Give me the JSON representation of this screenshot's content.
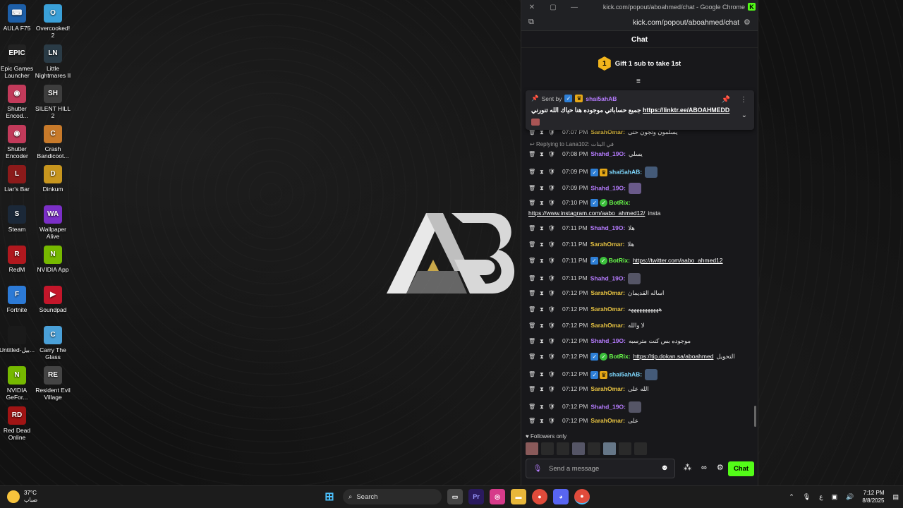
{
  "desktop": {
    "icons": [
      {
        "label": "AULA F75",
        "icon": "keyboard-app-icon",
        "color": "#1d5fa8",
        "glyph": "⌨"
      },
      {
        "label": "Overcooked! 2",
        "icon": "overcooked-icon",
        "color": "#3aa0d8",
        "glyph": "O"
      },
      {
        "label": "Epic Games Launcher",
        "icon": "epic-games-icon",
        "color": "#222222",
        "glyph": "EPIC"
      },
      {
        "label": "Little Nightmares II",
        "icon": "little-nightmares-icon",
        "color": "#2a3b46",
        "glyph": "LN"
      },
      {
        "label": "Shutter Encod...",
        "icon": "shutter-encoder-icon",
        "color": "#c23a5a",
        "glyph": "◉"
      },
      {
        "label": "SILENT HILL 2",
        "icon": "silent-hill-icon",
        "color": "#3d3d3d",
        "glyph": "SH"
      },
      {
        "label": "Shutter Encoder",
        "icon": "shutter-encoder-icon",
        "color": "#c23a5a",
        "glyph": "◉"
      },
      {
        "label": "Crash Bandicoot...",
        "icon": "crash-icon",
        "color": "#c87a2a",
        "glyph": "C"
      },
      {
        "label": "Liar's Bar",
        "icon": "liars-bar-icon",
        "color": "#8c1a1a",
        "glyph": "L"
      },
      {
        "label": "Dinkum",
        "icon": "dinkum-icon",
        "color": "#c8961e",
        "glyph": "D"
      },
      {
        "label": "Steam",
        "icon": "steam-icon",
        "color": "#1b2838",
        "glyph": "S"
      },
      {
        "label": "Wallpaper Alive",
        "icon": "wallpaper-alive-icon",
        "color": "#7b2fc7",
        "glyph": "WA"
      },
      {
        "label": "RedM",
        "icon": "redm-icon",
        "color": "#b0181e",
        "glyph": "R"
      },
      {
        "label": "NVIDIA App",
        "icon": "nvidia-icon",
        "color": "#76b900",
        "glyph": "N"
      },
      {
        "label": "Fortnite",
        "icon": "fortnite-icon",
        "color": "#2c7ad6",
        "glyph": "F"
      },
      {
        "label": "Soundpad",
        "icon": "soundpad-icon",
        "color": "#c4162a",
        "glyph": "▶"
      },
      {
        "label": "Untitled-بيل...",
        "icon": "untitled-file-icon",
        "color": "#1a1a1a",
        "glyph": ""
      },
      {
        "label": "Carry The Glass",
        "icon": "carry-the-glass-icon",
        "color": "#4aa0d8",
        "glyph": "C"
      },
      {
        "label": "NVIDIA GeFor...",
        "icon": "nvidia-geforce-icon",
        "color": "#76b900",
        "glyph": "N"
      },
      {
        "label": "Resident Evil Village",
        "icon": "resident-evil-icon",
        "color": "#444444",
        "glyph": "RE"
      },
      {
        "label": "Red Dead Online",
        "icon": "red-dead-icon",
        "color": "#a01414",
        "glyph": "RD"
      }
    ]
  },
  "chrome": {
    "title": "kick.com/popout/aboahmed/chat - Google Chrome",
    "url": "kick.com/popout/aboahmed/chat"
  },
  "chat": {
    "header": "Chat",
    "gift_badge": "1",
    "gift_text": "Gift 1 sub to take 1st",
    "pinned": {
      "sent_by_label": "Sent by",
      "sender": "shai5ahAB",
      "text": "جميع حساباتي موجوده هنا حياك الله تنورني",
      "link": "https://linktr.ee/ABOAHMEDD"
    },
    "messages": [
      {
        "time": "07:07 PM",
        "user": "SarahOmar:",
        "cls": "u-yellow",
        "text": "يسلمون وتجون حتى"
      },
      {
        "time": "07:08 PM",
        "user": "Shahd_19O:",
        "cls": "u-purple",
        "text": "يسلي"
      },
      {
        "time": "07:09 PM",
        "user": "shai5ahAB:",
        "cls": "u-cyan",
        "text": ""
      },
      {
        "time": "07:09 PM",
        "user": "Shahd_19O:",
        "cls": "u-purple",
        "text": ""
      },
      {
        "time": "07:10 PM",
        "user": "BotRix:",
        "cls": "u-green",
        "text": ""
      },
      {
        "time": "07:11 PM",
        "user": "Shahd_19O:",
        "cls": "u-purple",
        "text": "هلا"
      },
      {
        "time": "07:11 PM",
        "user": "SarahOmar:",
        "cls": "u-yellow",
        "text": "هلا"
      },
      {
        "time": "07:11 PM",
        "user": "BotRix:",
        "cls": "u-green",
        "text": ""
      },
      {
        "time": "07:11 PM",
        "user": "Shahd_19O:",
        "cls": "u-purple",
        "text": ""
      },
      {
        "time": "07:12 PM",
        "user": "SarahOmar:",
        "cls": "u-yellow",
        "text": "اساله القديمان"
      },
      {
        "time": "07:12 PM",
        "user": "SarahOmar:",
        "cls": "u-yellow",
        "text": "هههههههههههه"
      },
      {
        "time": "07:12 PM",
        "user": "SarahOmar:",
        "cls": "u-yellow",
        "text": "لا والله"
      },
      {
        "time": "07:12 PM",
        "user": "Shahd_19O:",
        "cls": "u-purple",
        "text": "موجوده بس كنت مترسبه"
      },
      {
        "time": "07:12 PM",
        "user": "BotRix:",
        "cls": "u-green",
        "text": "التحويل"
      },
      {
        "time": "07:12 PM",
        "user": "shai5ahAB:",
        "cls": "u-cyan",
        "text": ""
      },
      {
        "time": "07:12 PM",
        "user": "SarahOmar:",
        "cls": "u-yellow",
        "text": "الله على"
      },
      {
        "time": "07:12 PM",
        "user": "Shahd_19O:",
        "cls": "u-purple",
        "text": ""
      },
      {
        "time": "07:12 PM",
        "user": "SarahOmar:",
        "cls": "u-yellow",
        "text": "على"
      }
    ],
    "links": {
      "instagram": "https://www.instagram.com/aabo_ahmed12/",
      "instagram_suffix": "insta",
      "twitter": "https://twitter.com/aabo_ahmed12",
      "tip": "https://tip.dokan.sa/aboahmed"
    },
    "reply_text": "Replying to Lana102:",
    "reply_suffix": "في البنات",
    "followers_only": "Followers only",
    "input_placeholder": "Send a message",
    "send_label": "Chat",
    "accent": "#53fc18"
  },
  "taskbar": {
    "weather_temp": "37°C",
    "weather_desc": "ضباب",
    "search_label": "Search",
    "lang": "ع",
    "time": "7:12 PM",
    "date": "8/8/2025"
  }
}
